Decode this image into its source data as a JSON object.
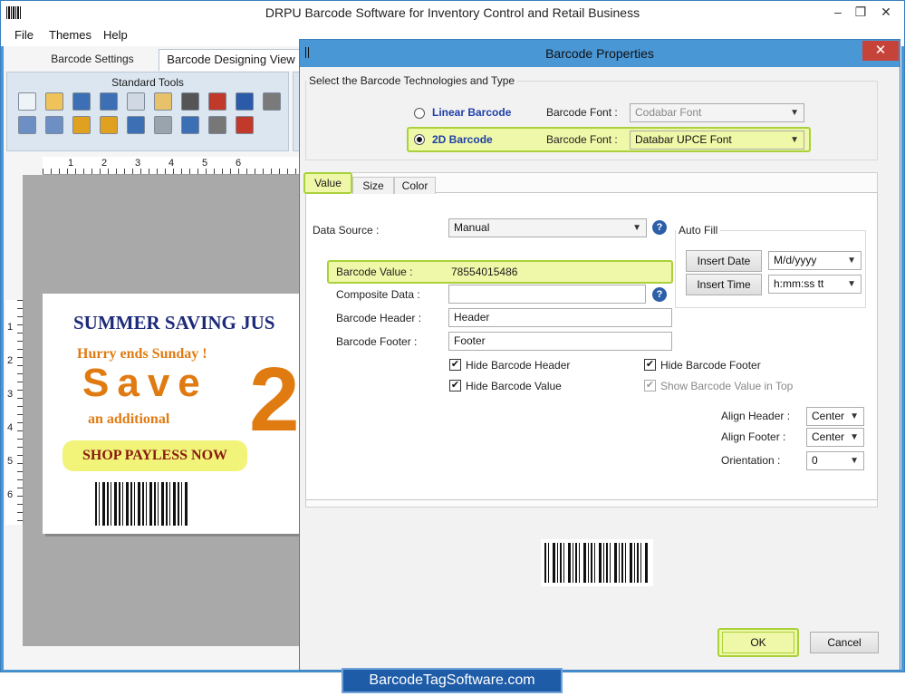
{
  "app": {
    "title": "DRPU Barcode Software for Inventory Control and Retail Business",
    "window_controls": {
      "minimize": "–",
      "restore": "❐",
      "close": "✕"
    }
  },
  "menu": [
    "File",
    "Themes",
    "Help"
  ],
  "tabs": {
    "barcode_settings": "Barcode Settings",
    "barcode_designing_view": "Barcode Designing View"
  },
  "toolbar": {
    "group_label": "Standard Tools",
    "icons": [
      "new-icon",
      "open-icon",
      "save-icon",
      "save-as-icon",
      "copy-icon",
      "paste-icon",
      "cut-icon",
      "delete-icon",
      "undo-icon",
      "redo-icon",
      "bring-front-icon",
      "send-back-icon",
      "lock-icon",
      "unlock-icon",
      "grid-icon",
      "database-icon",
      "export-icon",
      "print-icon",
      "exit-icon"
    ]
  },
  "rulers": {
    "top": [
      "1",
      "2",
      "3",
      "4",
      "5",
      "6"
    ],
    "left": [
      "1",
      "2",
      "3",
      "4",
      "5",
      "6"
    ]
  },
  "label": {
    "headline": "SUMMER SAVING JUS",
    "hurry": "Hurry ends Sunday !",
    "save": "Save",
    "additional": "an additional",
    "big_number": "2",
    "shop": "SHOP PAYLESS NOW"
  },
  "dialog": {
    "title": "Barcode Properties",
    "close": "✕",
    "tech_group": "Select the Barcode Technologies and Type",
    "linear": {
      "label": "Linear Barcode",
      "font_label": "Barcode Font :",
      "font_value": "Codabar Font",
      "selected": false
    },
    "twod": {
      "label": "2D Barcode",
      "font_label": "Barcode Font :",
      "font_value": "Databar UPCE Font",
      "selected": true
    },
    "tabs": [
      "Value",
      "Size",
      "Color"
    ],
    "data_source": {
      "label": "Data Source :",
      "value": "Manual"
    },
    "help": "?",
    "barcode_value": {
      "label": "Barcode Value :",
      "value": "78554015486"
    },
    "composite_data": {
      "label": "Composite Data :",
      "value": ""
    },
    "barcode_header": {
      "label": "Barcode Header :",
      "value": "Header"
    },
    "barcode_footer": {
      "label": "Barcode Footer :",
      "value": "Footer"
    },
    "checks": {
      "hide_header": {
        "label": "Hide Barcode Header",
        "checked": true
      },
      "hide_footer": {
        "label": "Hide Barcode Footer",
        "checked": true
      },
      "hide_value": {
        "label": "Hide Barcode Value",
        "checked": true
      },
      "show_top": {
        "label": "Show Barcode Value in Top",
        "checked": true
      }
    },
    "autofill": {
      "legend": "Auto Fill",
      "insert_date": "Insert Date",
      "date_format": "M/d/yyyy",
      "insert_time": "Insert Time",
      "time_format": "h:mm:ss tt"
    },
    "align_header": {
      "label": "Align Header :",
      "value": "Center"
    },
    "align_footer": {
      "label": "Align Footer :",
      "value": "Center"
    },
    "orientation": {
      "label": "Orientation :",
      "value": "0"
    },
    "ok": "OK",
    "cancel": "Cancel"
  },
  "brand": "BarcodeTagSoftware.com"
}
